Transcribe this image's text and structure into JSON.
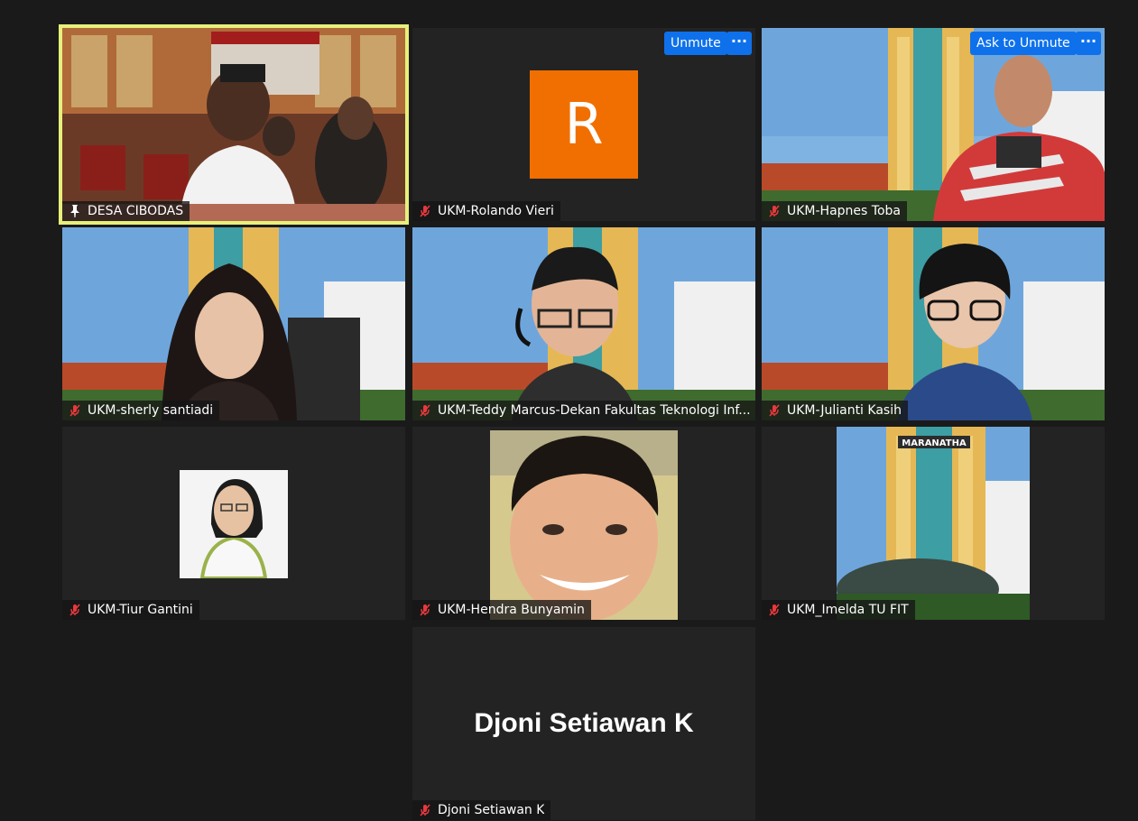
{
  "meeting": {
    "participants": [
      {
        "name": "DESA CIBODAS",
        "muted": false,
        "pinned": true,
        "active_speaker": true,
        "video": "classroom"
      },
      {
        "name": "UKM-Rolando Vieri",
        "muted": true,
        "avatar_letter": "R",
        "avatar_color": "#f06f00",
        "video": "avatar"
      },
      {
        "name": "UKM-Hapnes Toba",
        "muted": true,
        "video": "building-man"
      },
      {
        "name": "UKM-sherly santiadi",
        "muted": true,
        "video": "building-woman-young"
      },
      {
        "name": "UKM-Teddy Marcus-Dekan Fakultas Teknologi Inf...",
        "muted": true,
        "video": "building-man-headset"
      },
      {
        "name": "UKM-Julianti Kasih",
        "muted": true,
        "video": "building-woman-glasses"
      },
      {
        "name": "UKM-Tiur Gantini",
        "muted": true,
        "video": "photo-small"
      },
      {
        "name": "UKM-Hendra Bunyamin",
        "muted": true,
        "video": "selfie"
      },
      {
        "name": "UKM_Imelda TU FIT",
        "muted": true,
        "video": "building-only"
      },
      {
        "name": "Djoni Setiawan K",
        "muted": true,
        "display_name": "Djoni Setiawan K",
        "video": "name-only"
      }
    ],
    "buttons": {
      "unmute": "Unmute",
      "ask_to_unmute": "Ask to Unmute",
      "more": "···"
    },
    "colors": {
      "active_border": "#e6f07a",
      "button_blue": "#0e71eb",
      "muted_icon": "#e8383d",
      "background": "#1a1a1a"
    },
    "building_sign": "MARANATHA"
  }
}
